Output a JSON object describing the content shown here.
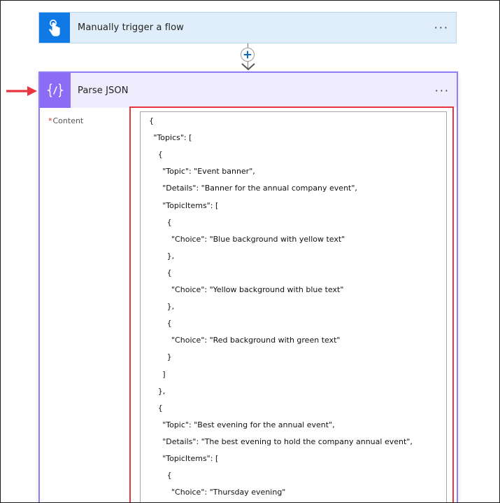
{
  "trigger": {
    "title": "Manually trigger a flow",
    "menu": "···",
    "icon": "touch-hand-icon",
    "color": "#0f7ae5"
  },
  "connector": {
    "icon": "add-step-icon"
  },
  "action": {
    "title": "Parse JSON",
    "menu": "···",
    "icon": "braces-icon",
    "color": "#8c6cf4",
    "field_required_mark": "*",
    "field_label": "Content",
    "content_lines": [
      "{",
      "  \"Topics\": [",
      "    {",
      "      \"Topic\": \"Event banner\",",
      "      \"Details\": \"Banner for the annual company event\",",
      "      \"TopicItems\": [",
      "        {",
      "          \"Choice\": \"Blue background with yellow text\"",
      "        },",
      "        {",
      "          \"Choice\": \"Yellow background with blue text\"",
      "        },",
      "        {",
      "          \"Choice\": \"Red background with green text\"",
      "        }",
      "      ]",
      "    },",
      "    {",
      "      \"Topic\": \"Best evening for the annual event\",",
      "      \"Details\": \"The best evening to hold the company annual event\",",
      "      \"TopicItems\": [",
      "        {",
      "          \"Choice\": \"Thursday evening\""
    ]
  },
  "annotation": {
    "arrow_color": "#e8353f",
    "highlight_color": "#e8353f"
  }
}
